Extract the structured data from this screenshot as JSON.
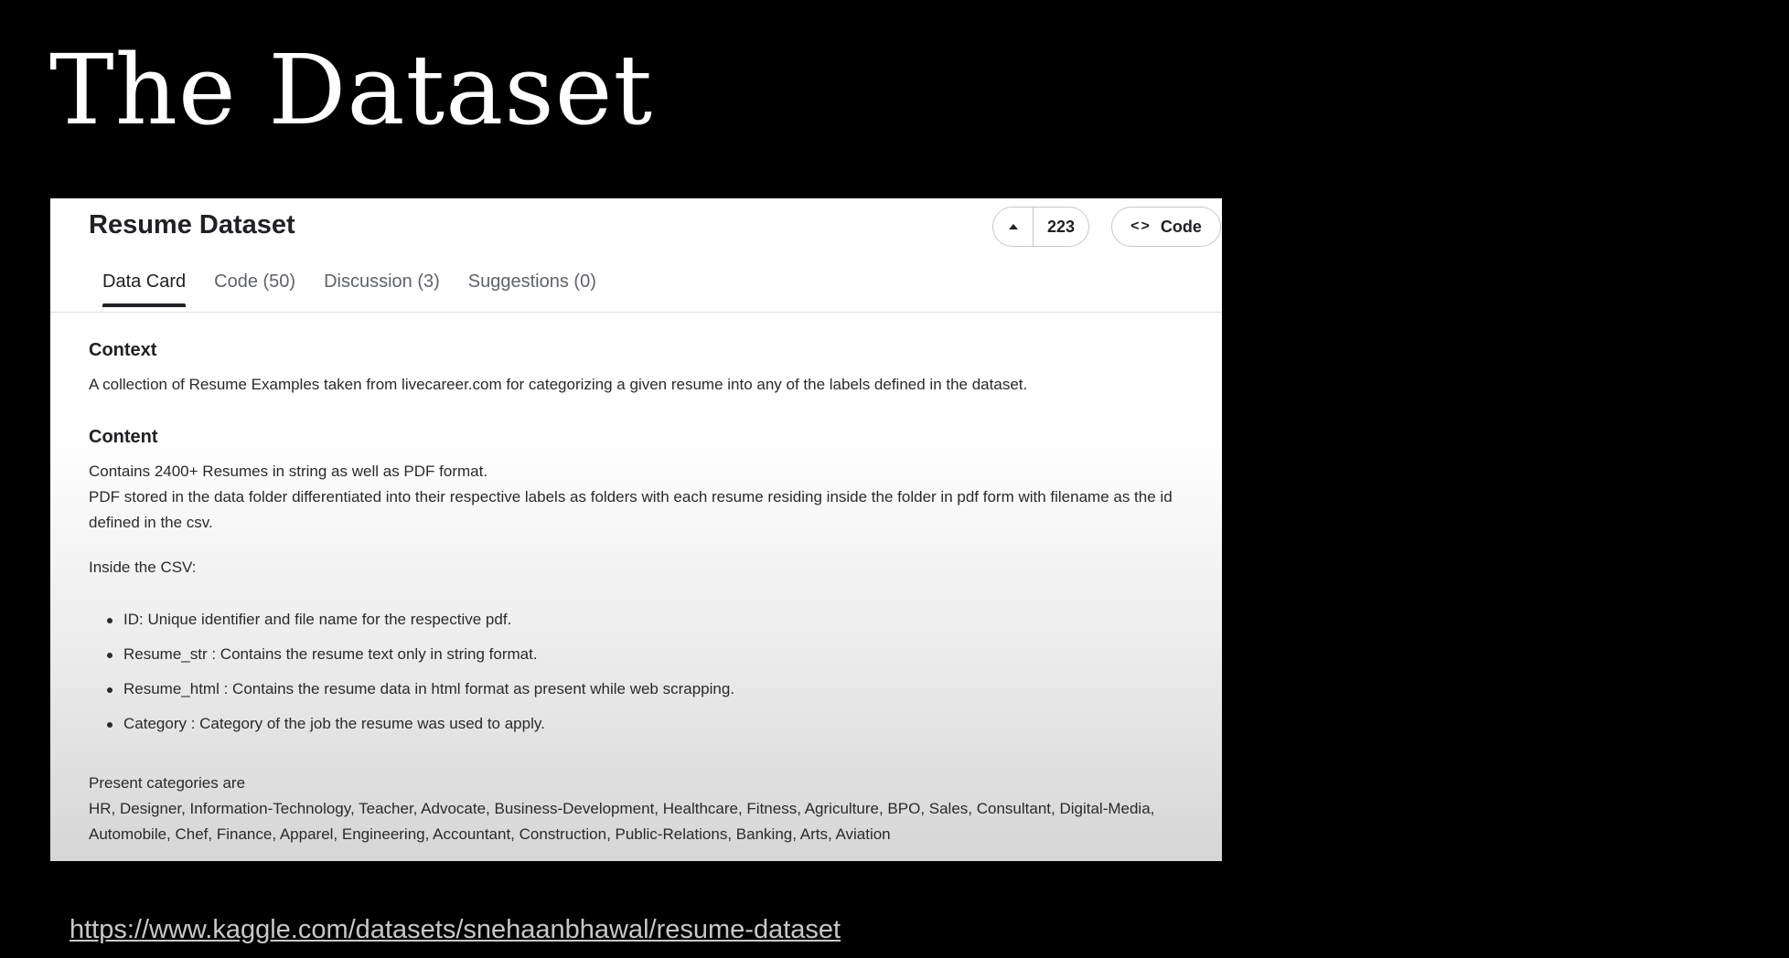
{
  "slide": {
    "title": "The Dataset",
    "link": "https://www.kaggle.com/datasets/snehaanbhawal/resume-dataset"
  },
  "dataset_page": {
    "title": "Resume Dataset",
    "vote_count": "223",
    "code_button_label": "Code",
    "tabs": [
      {
        "label": "Data Card",
        "active": true
      },
      {
        "label": "Code (50)"
      },
      {
        "label": "Discussion (3)"
      },
      {
        "label": "Suggestions (0)"
      }
    ],
    "context": {
      "heading": "Context",
      "text": "A collection of Resume Examples taken from livecareer.com for categorizing a given resume into any of the labels defined in the dataset."
    },
    "content": {
      "heading": "Content",
      "line1": "Contains 2400+ Resumes in string as well as PDF format.",
      "line2": "PDF stored in the data folder differentiated into their respective labels as folders with each resume residing inside the folder in pdf form with filename as the id defined in the csv.",
      "csv_intro": "Inside the CSV:",
      "bullets": [
        "ID: Unique identifier and file name for the respective pdf.",
        "Resume_str : Contains the resume text only in string format.",
        "Resume_html : Contains the resume data in html format as present while web scrapping.",
        "Category : Category of the job the resume was used to apply."
      ],
      "categories_intro": "Present categories are",
      "categories": "HR, Designer, Information-Technology, Teacher, Advocate, Business-Development, Healthcare, Fitness, Agriculture, BPO, Sales, Consultant, Digital-Media, Automobile, Chef, Finance, Apparel, Engineering, Accountant, Construction, Public-Relations, Banking, Arts, Aviation"
    }
  },
  "icons": {
    "upvote": "caret-up-icon",
    "code": "code-brackets-icon"
  }
}
